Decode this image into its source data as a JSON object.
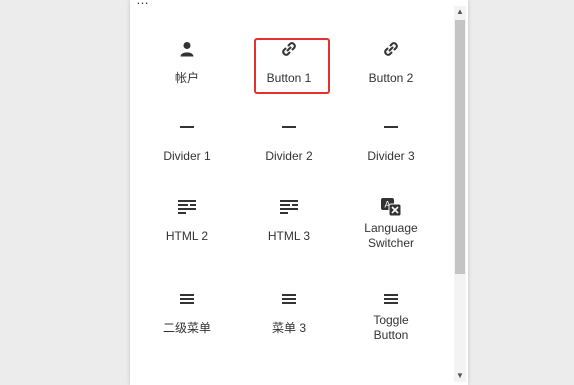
{
  "top_peek": "…",
  "items": [
    {
      "label": "帐户",
      "icon": "user-icon"
    },
    {
      "label": "Button 1",
      "icon": "link-icon"
    },
    {
      "label": "Button 2",
      "icon": "link-icon"
    },
    {
      "label": "Divider 1",
      "icon": "divider-icon"
    },
    {
      "label": "Divider 2",
      "icon": "divider-icon"
    },
    {
      "label": "Divider 3",
      "icon": "divider-icon"
    },
    {
      "label": "HTML 2",
      "icon": "text-lines-icon"
    },
    {
      "label": "HTML 3",
      "icon": "text-lines-icon"
    },
    {
      "label": "Language Switcher",
      "icon": "language-icon"
    },
    {
      "label": "二级菜单",
      "icon": "menu-icon"
    },
    {
      "label": "菜单 3",
      "icon": "menu-icon"
    },
    {
      "label": "Toggle Button",
      "icon": "menu-icon"
    }
  ],
  "highlight_color": "#e53030"
}
